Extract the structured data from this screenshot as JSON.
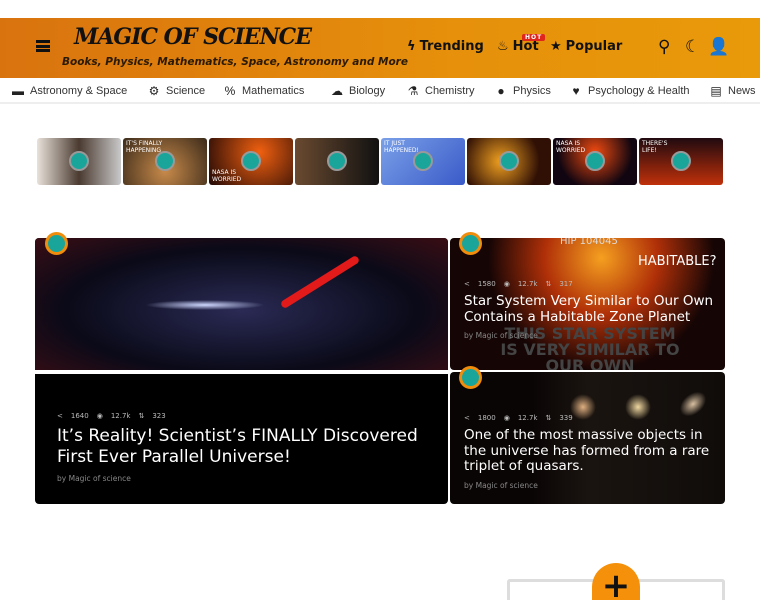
{
  "header": {
    "logo": "MAGIC OF SCIENCE",
    "tagline": "Books, Physics, Mathematics, Space, Astronomy and More",
    "nav": [
      {
        "label": "Trending",
        "icon": "bolt-icon"
      },
      {
        "label": "Hot",
        "icon": "flame-icon",
        "badge": "HOT"
      },
      {
        "label": "Popular",
        "icon": "star-icon"
      }
    ]
  },
  "categories": [
    {
      "label": "Astronomy & Space",
      "icon": "telescope-icon",
      "glyph": "▬"
    },
    {
      "label": "Science",
      "icon": "gear-icon",
      "glyph": "⚙"
    },
    {
      "label": "Mathematics",
      "icon": "percent-icon",
      "glyph": "%"
    },
    {
      "label": "Biology",
      "icon": "cloud-sun-icon",
      "glyph": "☁"
    },
    {
      "label": "Chemistry",
      "icon": "flask-icon",
      "glyph": "⚗"
    },
    {
      "label": "Physics",
      "icon": "lightbulb-icon",
      "glyph": "●"
    },
    {
      "label": "Psychology & Health",
      "icon": "heartbeat-icon",
      "glyph": "♥"
    },
    {
      "label": "News",
      "icon": "newspaper-icon",
      "glyph": "▤"
    }
  ],
  "thumbnails": [
    {
      "caption": "",
      "bg": "linear-gradient(90deg,#e9e2da,#4a3a30 50%,#c9c9c9)"
    },
    {
      "caption": "IT'S FINALLY HAPPENING",
      "bg": "radial-gradient(circle at 50% 70%,#c88a4a,#3a2a1a)"
    },
    {
      "caption": "NASA IS WORRIED",
      "bg": "radial-gradient(circle at 60% 30%,#f06010,#200805)",
      "bottom": true
    },
    {
      "caption": "",
      "bg": "linear-gradient(90deg,#6a4a30,#111)"
    },
    {
      "caption": "IT JUST HAPPENED!",
      "bg": "linear-gradient(135deg,#7aa0e8,#3a5ac8)"
    },
    {
      "caption": "",
      "bg": "radial-gradient(circle at 40% 50%,#f0a020,#301005 70%)"
    },
    {
      "caption": "NASA IS WORRIED",
      "bg": "radial-gradient(circle at 50% 30%,#f04a10,#100510 70%)"
    },
    {
      "caption": "THERE'S LIFE!",
      "bg": "linear-gradient(180deg,#200a10,#c0300a)"
    }
  ],
  "posts": [
    {
      "shares": "1640",
      "views": "12.7k",
      "votes": "323",
      "title": "It’s Reality! Scientist’s FINALLY Discovered First Ever Parallel Universe!",
      "author": "Magic of science"
    },
    {
      "shares": "1580",
      "views": "12.7k",
      "votes": "317",
      "title": "Star System Very Similar to Our Own Contains a Habitable Zone Planet",
      "author": "Magic of science",
      "image_text": [
        "HIP 104045",
        "HABITABLE?",
        "THIS STAR SYSTEM IS VERY SIMILAR TO OUR OWN"
      ]
    },
    {
      "shares": "1800",
      "views": "12.7k",
      "votes": "339",
      "title": "One of the most massive objects in the universe has formed from a rare triplet of quasars.",
      "author": "Magic of science"
    }
  ],
  "by_label": "by",
  "accent": "#f5900a"
}
